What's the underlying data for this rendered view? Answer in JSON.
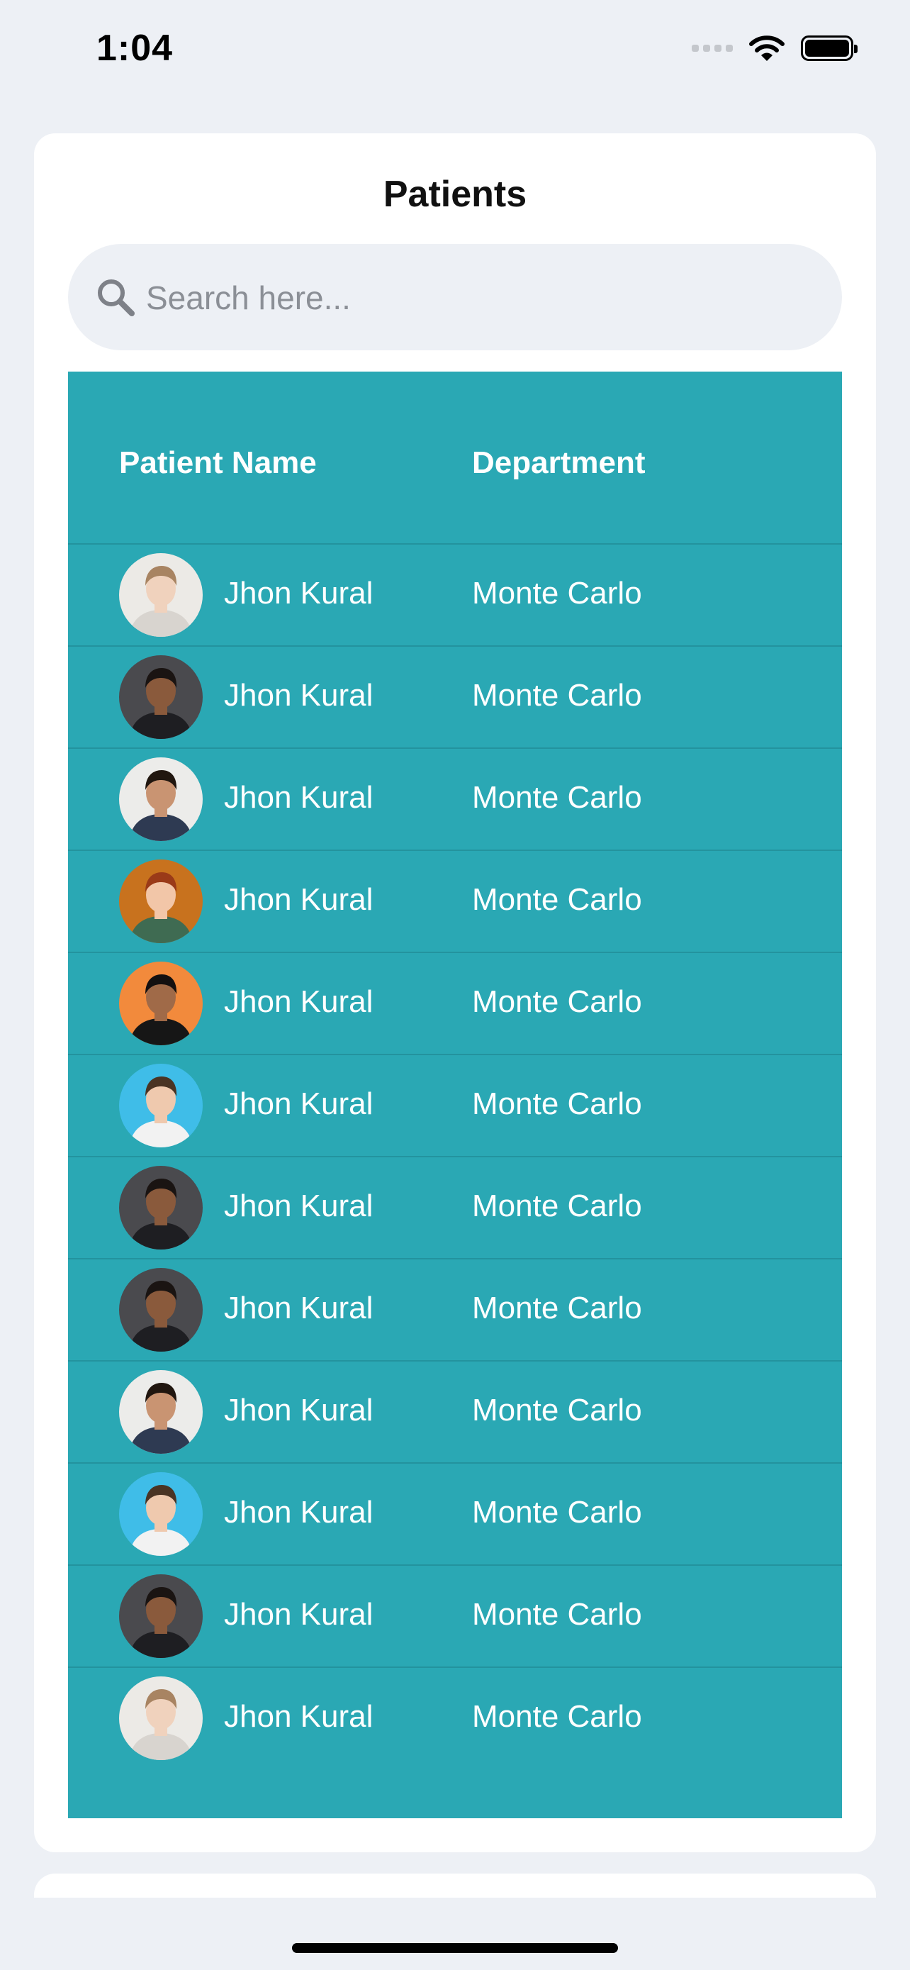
{
  "status_bar": {
    "time": "1:04"
  },
  "title": "Patients",
  "search": {
    "placeholder": "Search here..."
  },
  "table": {
    "columns": [
      "Patient Name",
      "Department"
    ],
    "rows": [
      {
        "name": "Jhon Kural",
        "department": "Monte Carlo",
        "avatar": "woman-light-bg"
      },
      {
        "name": "Jhon Kural",
        "department": "Monte Carlo",
        "avatar": "man-dark-bg"
      },
      {
        "name": "Jhon Kural",
        "department": "Monte Carlo",
        "avatar": "bearded-man-light-bg"
      },
      {
        "name": "Jhon Kural",
        "department": "Monte Carlo",
        "avatar": "woman-orange-bg"
      },
      {
        "name": "Jhon Kural",
        "department": "Monte Carlo",
        "avatar": "man-orange-bg"
      },
      {
        "name": "Jhon Kural",
        "department": "Monte Carlo",
        "avatar": "man-glasses-blue-bg"
      },
      {
        "name": "Jhon Kural",
        "department": "Monte Carlo",
        "avatar": "man-dark-bg"
      },
      {
        "name": "Jhon Kural",
        "department": "Monte Carlo",
        "avatar": "man-dark-bg"
      },
      {
        "name": "Jhon Kural",
        "department": "Monte Carlo",
        "avatar": "bearded-man-light-bg"
      },
      {
        "name": "Jhon Kural",
        "department": "Monte Carlo",
        "avatar": "man-glasses-blue-bg"
      },
      {
        "name": "Jhon Kural",
        "department": "Monte Carlo",
        "avatar": "man-dark-bg"
      },
      {
        "name": "Jhon Kural",
        "department": "Monte Carlo",
        "avatar": "woman-light-bg"
      }
    ]
  },
  "colors": {
    "background": "#edf0f5",
    "table": "#2aa8b4",
    "table_divider": "#23939e",
    "card": "#ffffff"
  }
}
